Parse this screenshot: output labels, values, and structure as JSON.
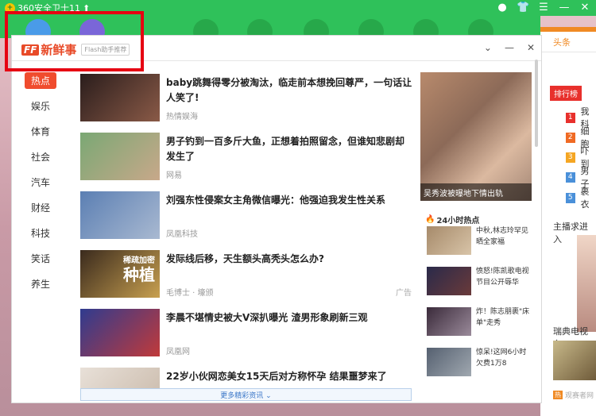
{
  "app": {
    "title": "360安全卫士11",
    "update_arrow": "⬆"
  },
  "window_controls": [
    "●",
    "👕",
    "☰",
    "—",
    "✕"
  ],
  "popup": {
    "brand_ff": "FF",
    "brand_name": "新鲜事",
    "brand_sub": "Flash助手推荐",
    "controls": [
      "⌄",
      "—",
      "✕"
    ]
  },
  "categories": [
    "热点",
    "娱乐",
    "体育",
    "社会",
    "汽车",
    "财经",
    "科技",
    "笑话",
    "养生"
  ],
  "feed": [
    {
      "title": "baby跳舞得零分被淘汰，临走前本想挽回尊严，一句话让人笑了!",
      "source": "热情娱海",
      "ad": "",
      "thumb_colors": [
        "#2a1d1c",
        "#8a5a47"
      ]
    },
    {
      "title": "男子钓到一百多斤大鱼，正想着拍照留念，但谁知悲剧却发生了",
      "source": "网易",
      "ad": "",
      "thumb_colors": [
        "#7aa874",
        "#c8a88a"
      ]
    },
    {
      "title": "刘强东性侵案女主角微信曝光：他强迫我发生性关系",
      "source": "凤凰科技",
      "ad": "",
      "thumb_colors": [
        "#5b7fb3",
        "#a9b9d1"
      ]
    },
    {
      "title": "发际线后移，天生额头高秃头怎么办?",
      "source": "毛博士 · 壕颁",
      "ad": "广告",
      "thumb_colors": [
        "#3a2a1d",
        "#c8a050"
      ],
      "thumb_text": [
        "稀疏加密",
        "种植"
      ]
    },
    {
      "title": "李晨不堪情史被大V深扒曝光 渣男形象刷新三观",
      "source": "凤凰网",
      "ad": "",
      "thumb_colors": [
        "#2f3b8f",
        "#c13a3a"
      ]
    },
    {
      "title": "22岁小伙网恋美女15天后对方称怀孕 结果噩梦来了",
      "source": "",
      "ad": "",
      "thumb_colors": [
        "#e8e0d8",
        "#c8b8a8"
      ]
    }
  ],
  "more_label": "更多精彩资讯 ⌄",
  "featured": {
    "caption": "吴秀波被曝地下情出轨"
  },
  "hot": {
    "header": "24小时热点",
    "items": [
      {
        "text": "中秋,林志玲罕见晒全家福",
        "colors": [
          "#a68a6a",
          "#d8c4a8"
        ]
      },
      {
        "text": "愤怒!陈凯歌电视节目公开辱华",
        "colors": [
          "#2a2a4a",
          "#6a3a3a"
        ]
      },
      {
        "text": "炸！陈志朋裹\"床单\"走秀",
        "colors": [
          "#3a2a3a",
          "#9a8a9a"
        ]
      },
      {
        "text": "惊呆!这网6小时欠费1万8",
        "colors": [
          "#556070",
          "#a0a8b0"
        ]
      }
    ]
  },
  "right_panel": {
    "tab": "头条",
    "rank_label": "排行榜",
    "rank_items": [
      {
        "num": "1",
        "text": "我科",
        "color": "#e8302c"
      },
      {
        "num": "2",
        "text": "细胞",
        "color": "#f06a24"
      },
      {
        "num": "3",
        "text": "吓到",
        "color": "#f5a623"
      },
      {
        "num": "4",
        "text": "男子",
        "color": "#4a90d9"
      },
      {
        "num": "5",
        "text": "裹衣",
        "color": "#4a90d9"
      }
    ],
    "section1": "主播求进入",
    "section2": "瑞典电视台",
    "footer_badge": "热",
    "footer_text": "观赛者网"
  }
}
